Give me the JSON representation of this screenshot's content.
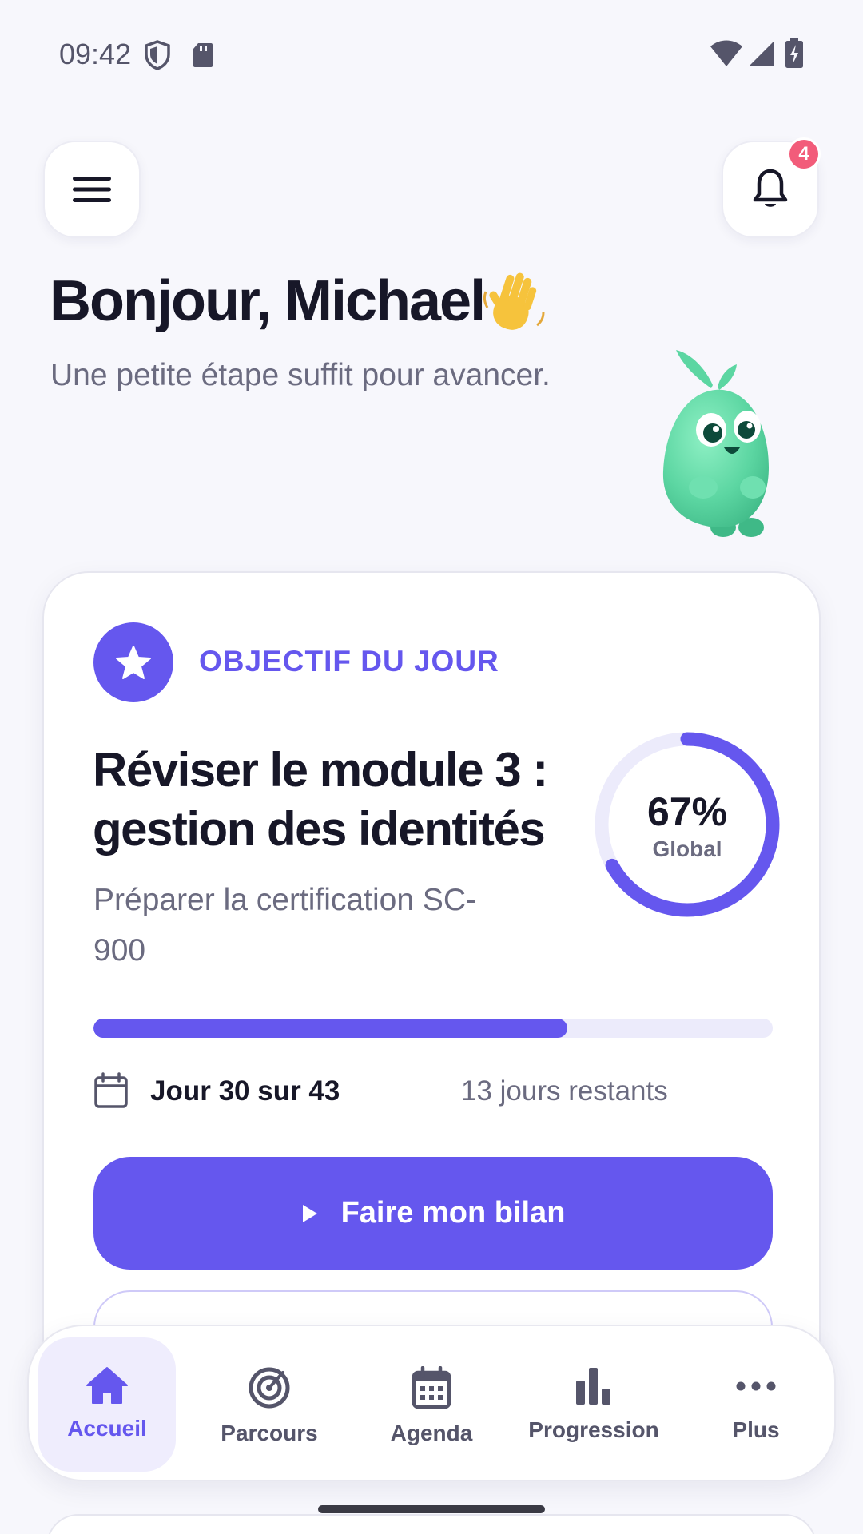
{
  "status_bar": {
    "time": "09:42"
  },
  "header": {
    "notification_count": "4"
  },
  "greeting": {
    "title": "Bonjour, Michael",
    "wave_emoji": "👋",
    "subtitle": "Une petite étape suffit pour avancer."
  },
  "goal_card": {
    "label": "OBJECTIF DU JOUR",
    "title": "Réviser le module 3 : gestion des identités",
    "subtitle": "Préparer la certification SC-900",
    "global_progress_value": 67,
    "global_progress_text": "67%",
    "global_progress_label": "Global",
    "day_progress_fraction": 0.698,
    "day_text": "Jour 30 sur 43",
    "remaining_text": "13 jours restants",
    "primary_button_label": "Faire mon bilan"
  },
  "bottom_nav": {
    "items": [
      {
        "label": "Accueil",
        "icon": "home-icon",
        "active": true
      },
      {
        "label": "Parcours",
        "icon": "target-icon",
        "active": false
      },
      {
        "label": "Agenda",
        "icon": "calendar-icon",
        "active": false
      },
      {
        "label": "Progression",
        "icon": "bar-chart-icon",
        "active": false
      },
      {
        "label": "Plus",
        "icon": "more-icon",
        "active": false
      }
    ]
  },
  "colors": {
    "accent": "#6557ee",
    "accent_light": "#ecebfb",
    "badge": "#f25c7a",
    "background": "#f7f7fc",
    "text_dark": "#171728",
    "text_muted": "#6b6b80"
  }
}
